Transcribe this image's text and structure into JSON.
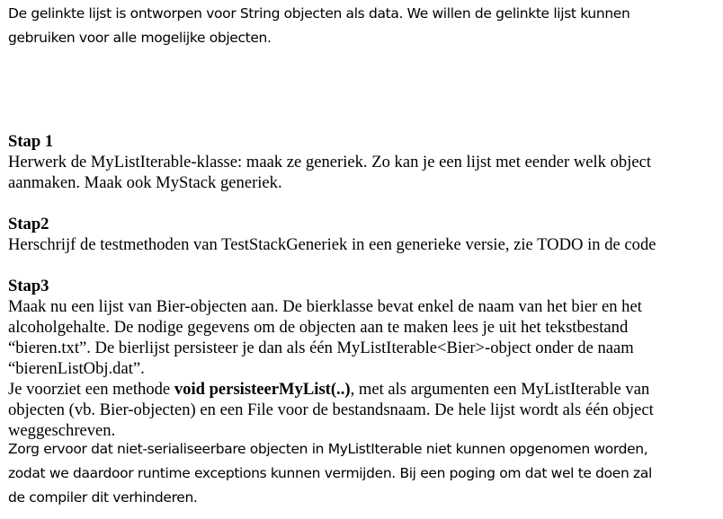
{
  "intro": {
    "line1": "De gelinkte lijst is ontworpen voor String objecten als data. We willen de gelinkte lijst kunnen",
    "line2": "gebruiken voor alle mogelijke objecten."
  },
  "step1": {
    "heading": "Stap 1",
    "line1": "Herwerk de MyListIterable-klasse: maak ze generiek. Zo kan je een lijst met eender welk object",
    "line2": "aanmaken. Maak ook MyStack generiek."
  },
  "step2": {
    "heading": "Stap2",
    "line1": "Herschrijf de testmethoden van TestStackGeneriek in een generieke versie, zie TODO in de code"
  },
  "step3": {
    "heading": "Stap3",
    "line1": "Maak nu een lijst van Bier-objecten aan. De bierklasse bevat enkel de naam van het bier en het",
    "line2": "alcoholgehalte. De nodige gegevens om de objecten aan te maken lees je uit het tekstbestand",
    "line3": "“bieren.txt”. De bierlijst persisteer je dan als één MyListIterable<Bier>-object onder de naam",
    "line4": "“bierenListObj.dat”.",
    "line5_pre": "Je voorziet een methode ",
    "line5_bold": "void persisteerMyList(..)",
    "line5_post": ", met als argumenten een MyListIterable van",
    "line6": "objecten (vb. Bier-objecten) en een File voor de bestandsnaam. De hele lijst wordt als één object",
    "line7": "weggeschreven."
  },
  "closing": {
    "line1": "Zorg ervoor dat niet-serialiseerbare objecten in MyListIterable niet kunnen opgenomen worden,",
    "line2": "zodat we daardoor runtime exceptions kunnen vermijden. Bij een poging om dat wel te doen zal",
    "line3": "de compiler dit verhinderen."
  }
}
